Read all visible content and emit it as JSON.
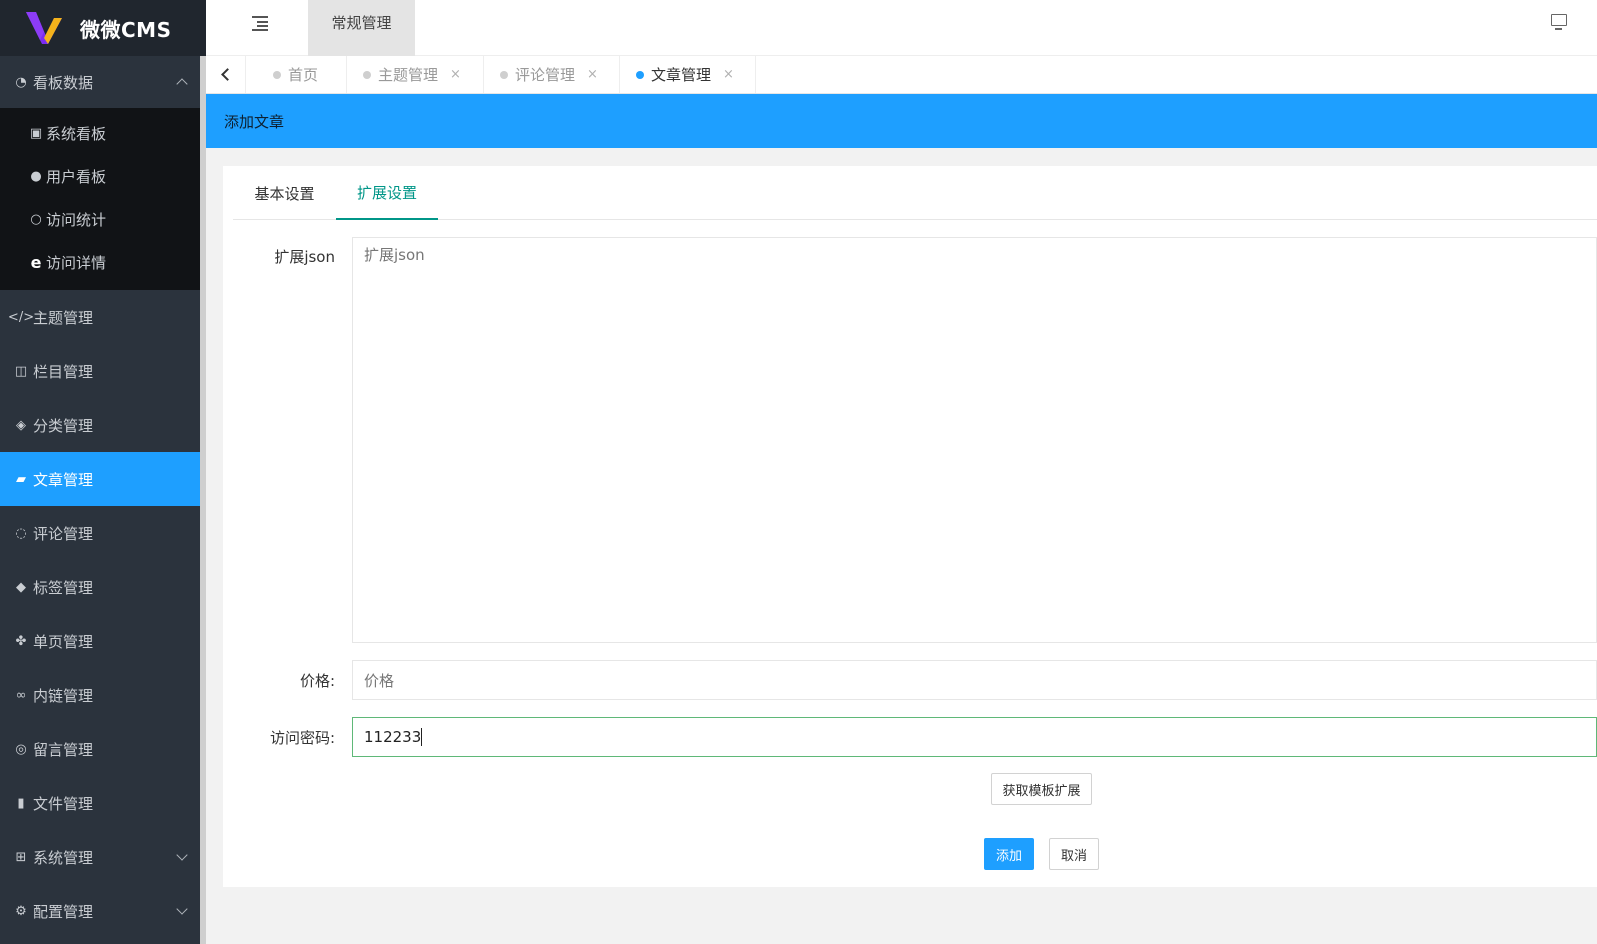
{
  "app": {
    "name": "微微CMS"
  },
  "colors": {
    "sidebar": "#2b333d",
    "accent": "#1e9fff",
    "tab_active": "#009688"
  },
  "sidebar": {
    "groups": [
      {
        "label": "看板数据",
        "icon": "dashboard-icon",
        "expanded": true,
        "children": [
          {
            "label": "系统看板",
            "icon": "image-icon"
          },
          {
            "label": "用户看板",
            "icon": "user-icon"
          },
          {
            "label": "访问统计",
            "icon": "user-outline-icon"
          },
          {
            "label": "访问详情",
            "icon": "ie-browser-icon"
          }
        ]
      },
      {
        "label": "主题管理",
        "icon": "code-icon"
      },
      {
        "label": "栏目管理",
        "icon": "columns-icon"
      },
      {
        "label": "分类管理",
        "icon": "cube-icon"
      },
      {
        "label": "文章管理",
        "icon": "book-icon",
        "active": true
      },
      {
        "label": "评论管理",
        "icon": "comment-icon"
      },
      {
        "label": "标签管理",
        "icon": "tags-icon"
      },
      {
        "label": "单页管理",
        "icon": "pagelines-icon"
      },
      {
        "label": "内链管理",
        "icon": "link-icon"
      },
      {
        "label": "留言管理",
        "icon": "comments-icon"
      },
      {
        "label": "文件管理",
        "icon": "file-icon"
      },
      {
        "label": "系统管理",
        "icon": "windows-icon",
        "collapsible": true
      },
      {
        "label": "配置管理",
        "icon": "cogs-icon",
        "collapsible": true
      }
    ]
  },
  "header": {
    "menu_toggle_icon": "indent-icon",
    "tab_label": "常规管理",
    "right_icon": "monitor-icon"
  },
  "tabs": {
    "prev_icon": "chevron-left-icon",
    "items": [
      {
        "label": "首页"
      },
      {
        "label": "主题管理",
        "closable": true
      },
      {
        "label": "评论管理",
        "closable": true
      },
      {
        "label": "文章管理",
        "closable": true,
        "active": true
      }
    ],
    "close_glyph": "×"
  },
  "page": {
    "banner_title": "添加文章"
  },
  "form": {
    "tabs": [
      {
        "label": "基本设置"
      },
      {
        "label": "扩展设置",
        "active": true
      }
    ],
    "ext_json": {
      "label": "扩展json",
      "placeholder": "扩展json",
      "value": ""
    },
    "price": {
      "label": "价格:",
      "placeholder": "价格",
      "value": ""
    },
    "password": {
      "label": "访问密码:",
      "value": "112233"
    },
    "fetch_button": "获取模板扩展",
    "submit_button": "添加",
    "cancel_button": "取消"
  }
}
